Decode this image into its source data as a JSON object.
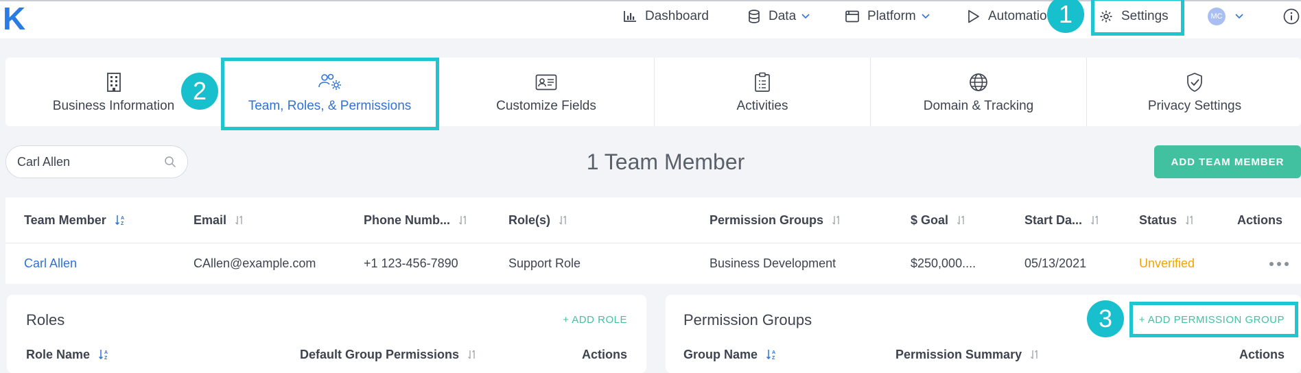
{
  "logo": "K",
  "nav": {
    "items": [
      {
        "label": "Dashboard",
        "icon": "bar-chart-icon"
      },
      {
        "label": "Data",
        "icon": "database-icon"
      },
      {
        "label": "Platform",
        "icon": "window-icon"
      },
      {
        "label": "Automatio",
        "icon": "play-icon"
      },
      {
        "label": "Settings",
        "icon": "gear-icon"
      }
    ],
    "avatar_initials": "MC"
  },
  "tabs": [
    {
      "label": "Business Information",
      "icon": "building-icon"
    },
    {
      "label": "Team, Roles, & Permissions",
      "icon": "team-gear-icon"
    },
    {
      "label": "Customize Fields",
      "icon": "id-card-icon"
    },
    {
      "label": "Activities",
      "icon": "clipboard-icon"
    },
    {
      "label": "Domain & Tracking",
      "icon": "globe-icon"
    },
    {
      "label": "Privacy Settings",
      "icon": "shield-check-icon"
    }
  ],
  "search": {
    "value": "Carl Allen"
  },
  "member_count": "1 Team Member",
  "add_member_label": "ADD TEAM MEMBER",
  "team_table": {
    "headers": [
      "Team Member",
      "Email",
      "Phone Numb...",
      "Role(s)",
      "Permission Groups",
      "$ Goal",
      "Start Da...",
      "Status",
      "Actions"
    ],
    "rows": [
      [
        "Carl Allen",
        "CAllen@example.com",
        "+1 123-456-7890",
        "Support Role",
        "Business Development",
        "$250,000....",
        "05/13/2021",
        "Unverified"
      ]
    ]
  },
  "roles": {
    "title": "Roles",
    "add_label": "+ ADD ROLE",
    "headers": [
      "Role Name",
      "Default Group Permissions",
      "Actions"
    ]
  },
  "permission_groups": {
    "title": "Permission Groups",
    "add_label": "+ ADD PERMISSION GROUP",
    "headers": [
      "Group Name",
      "Permission Summary",
      "Actions"
    ]
  },
  "annotations": [
    "1",
    "2",
    "3"
  ],
  "colors": {
    "accent_blue": "#2e72d9",
    "highlight_cyan": "#1fc5cf",
    "button_green": "#41c1a0",
    "status_warning": "#f0a30a"
  }
}
